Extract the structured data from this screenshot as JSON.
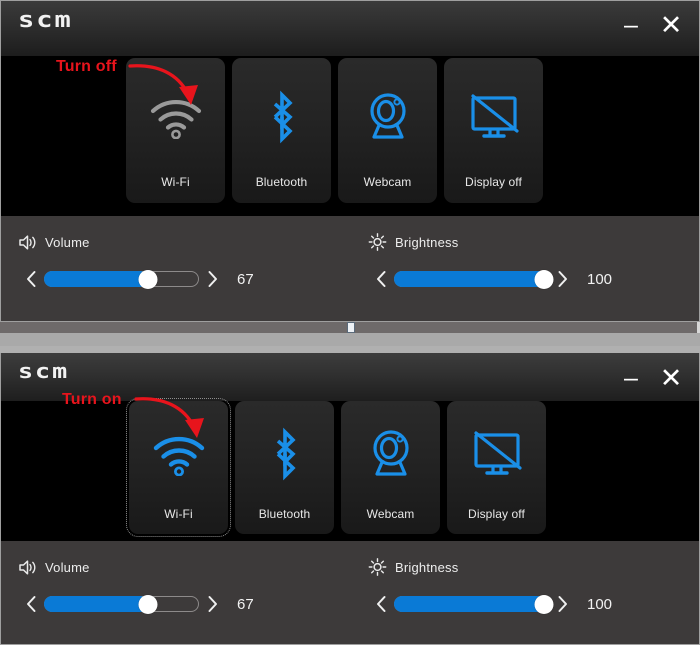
{
  "app": {
    "logo": "scm",
    "minimize_label": "–",
    "close_label": "✕"
  },
  "panels": [
    {
      "id": "panel-wifi-off",
      "annotation": {
        "text": "Turn off",
        "color": "#e8141c",
        "target": "wifi-tile"
      },
      "tiles": [
        {
          "id": "wifi",
          "label": "Wi-Fi",
          "icon": "wifi-icon",
          "state": "off",
          "color": "#9a9a9a",
          "focused": false
        },
        {
          "id": "bluetooth",
          "label": "Bluetooth",
          "icon": "bluetooth-icon",
          "state": "on",
          "color": "#1a8fe8",
          "focused": false
        },
        {
          "id": "webcam",
          "label": "Webcam",
          "icon": "webcam-icon",
          "state": "on",
          "color": "#1a8fe8",
          "focused": false
        },
        {
          "id": "display",
          "label": "Display off",
          "icon": "display-off-icon",
          "state": "on",
          "color": "#1a8fe8",
          "focused": false
        }
      ],
      "sliders": [
        {
          "id": "volume",
          "label": "Volume",
          "icon": "speaker-icon",
          "value": 67,
          "min": 0,
          "max": 100,
          "display": "67"
        },
        {
          "id": "brightness",
          "label": "Brightness",
          "icon": "brightness-icon",
          "value": 100,
          "min": 0,
          "max": 100,
          "display": "100"
        }
      ]
    },
    {
      "id": "panel-wifi-on",
      "annotation": {
        "text": "Turn on",
        "color": "#e8141c",
        "target": "wifi-tile"
      },
      "tiles": [
        {
          "id": "wifi",
          "label": "Wi-Fi",
          "icon": "wifi-icon",
          "state": "on",
          "color": "#1a8fe8",
          "focused": true
        },
        {
          "id": "bluetooth",
          "label": "Bluetooth",
          "icon": "bluetooth-icon",
          "state": "on",
          "color": "#1a8fe8",
          "focused": false
        },
        {
          "id": "webcam",
          "label": "Webcam",
          "icon": "webcam-icon",
          "state": "on",
          "color": "#1a8fe8",
          "focused": false
        },
        {
          "id": "display",
          "label": "Display off",
          "icon": "display-off-icon",
          "state": "on",
          "color": "#1a8fe8",
          "focused": false
        }
      ],
      "sliders": [
        {
          "id": "volume",
          "label": "Volume",
          "icon": "speaker-icon",
          "value": 67,
          "min": 0,
          "max": 100,
          "display": "67"
        },
        {
          "id": "brightness",
          "label": "Brightness",
          "icon": "brightness-icon",
          "value": 100,
          "min": 0,
          "max": 100,
          "display": "100"
        }
      ]
    }
  ]
}
